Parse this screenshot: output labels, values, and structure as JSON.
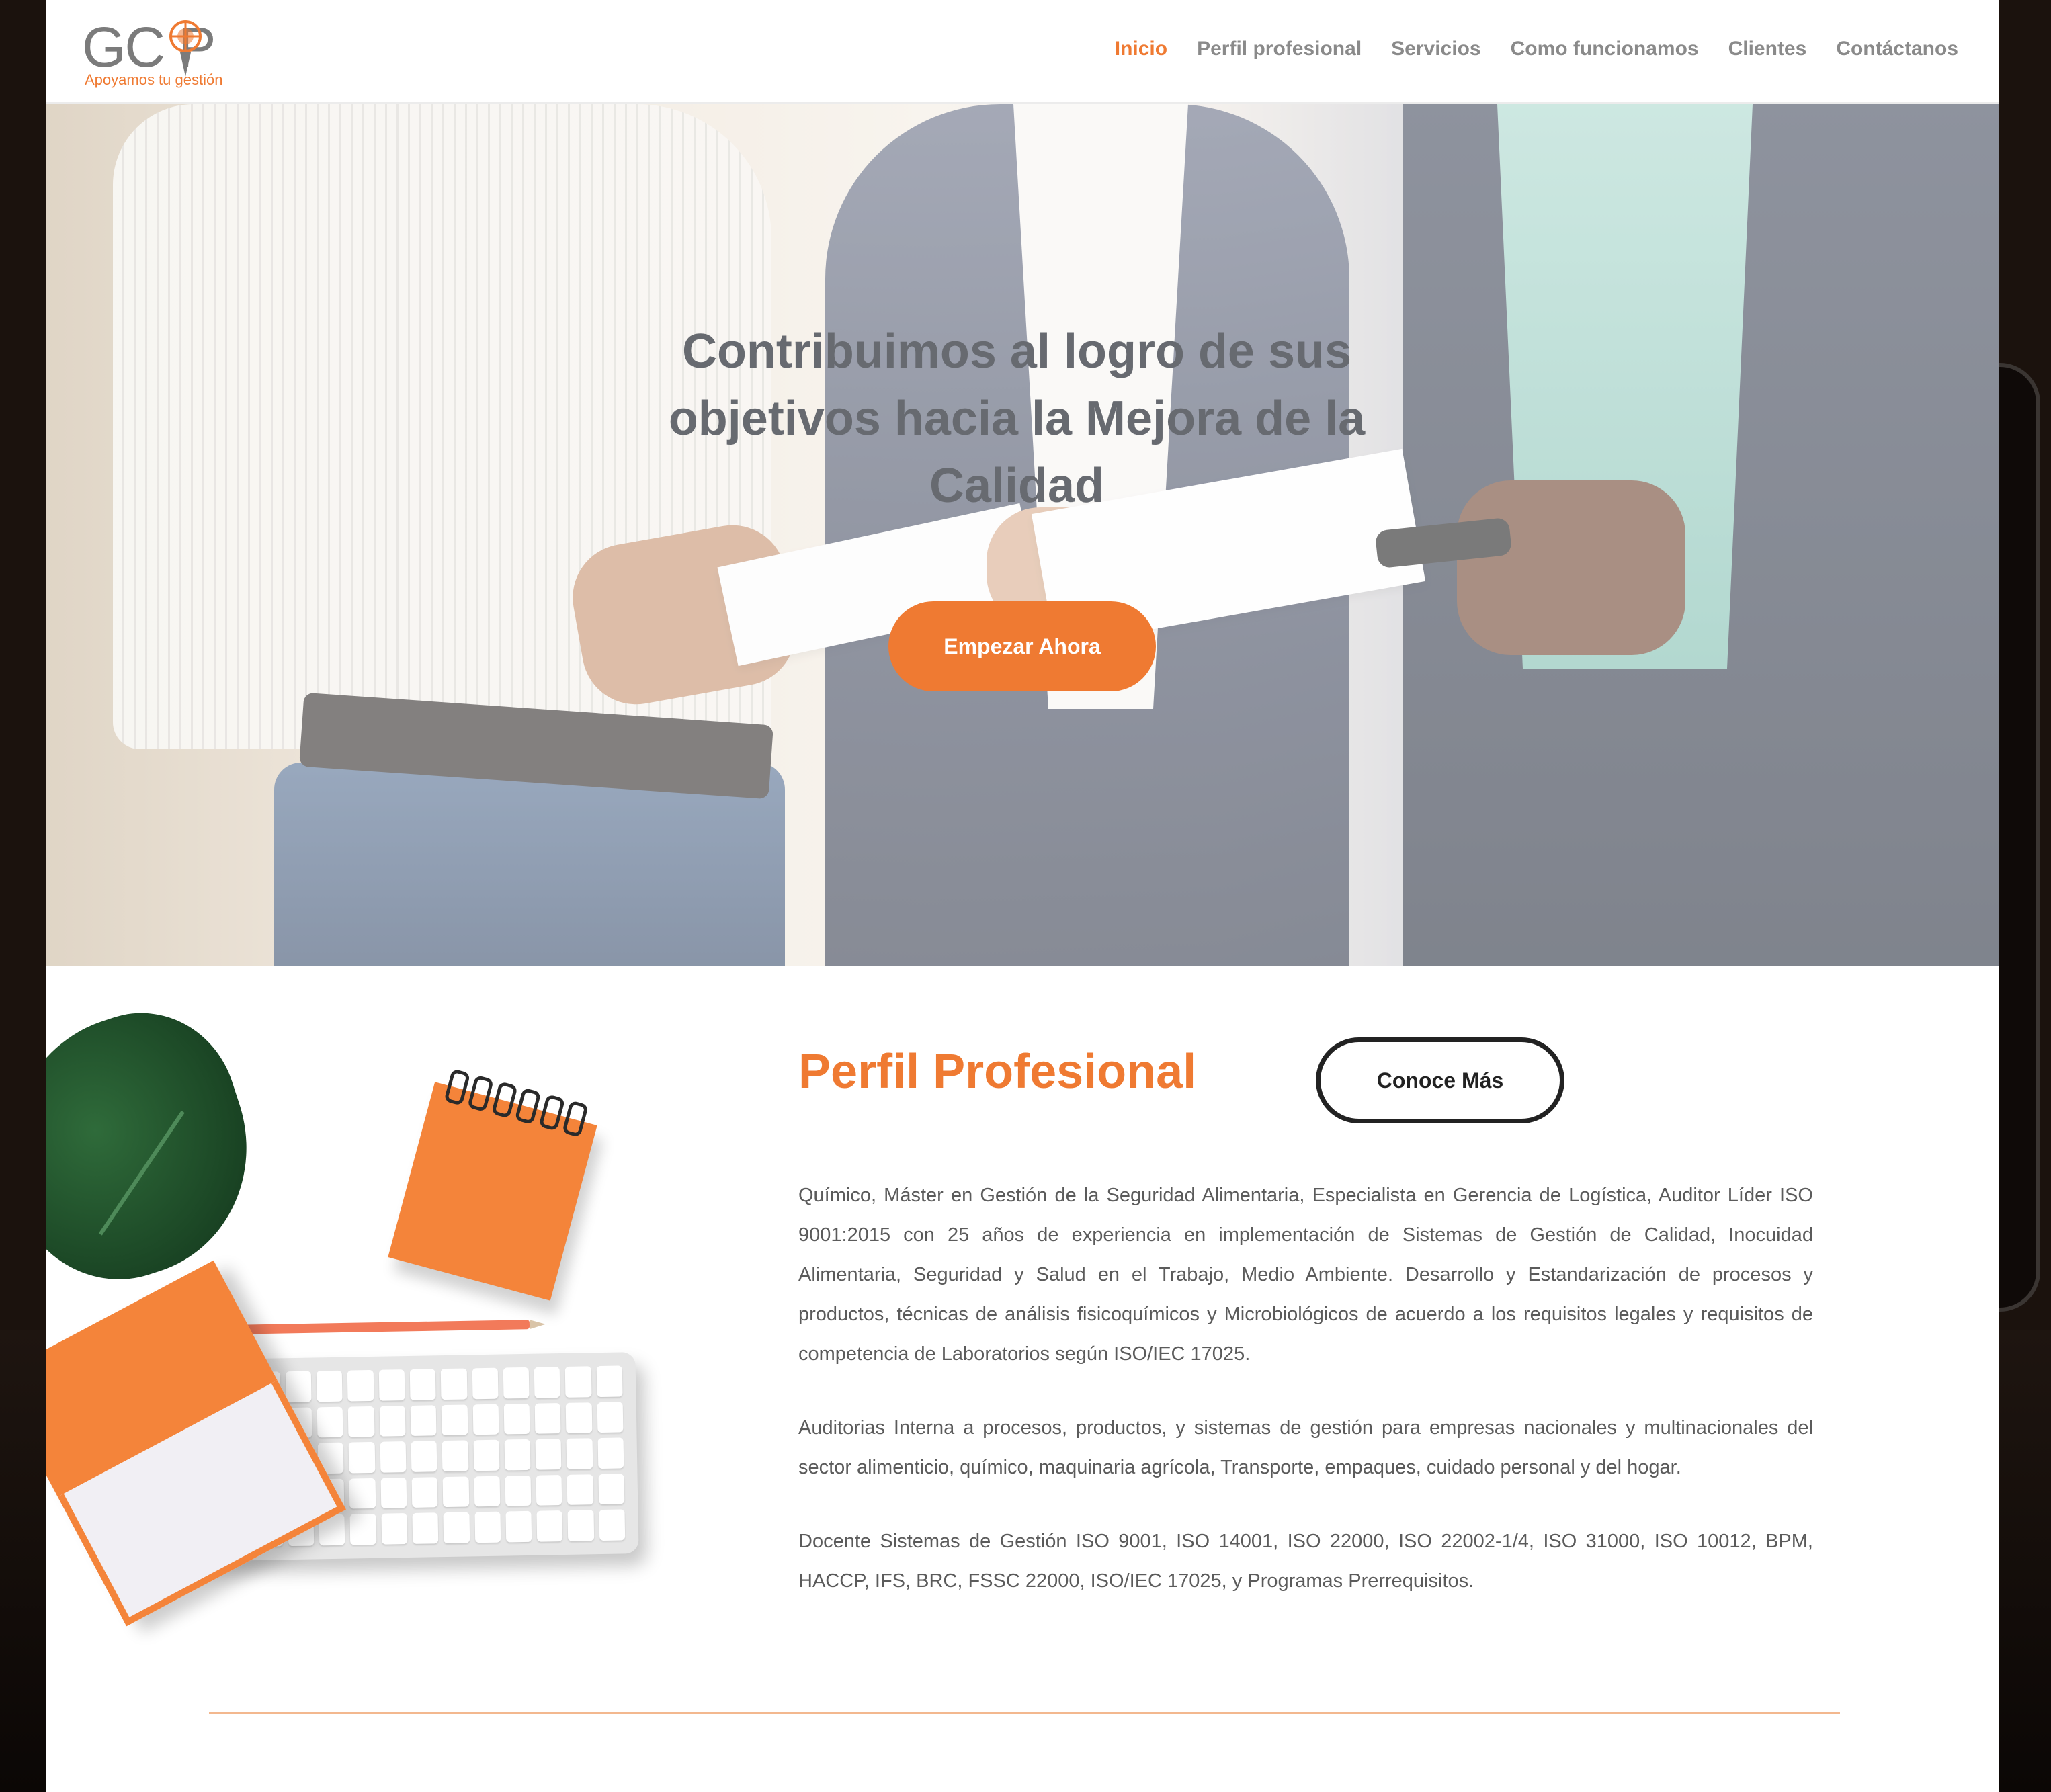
{
  "colors": {
    "accent": "#ef7a32",
    "nav_text": "#8a8a8a",
    "hero_text": "#676a70",
    "body_text": "#5b5b5b",
    "divider": "#f3b88f"
  },
  "header": {
    "logo_text": "GC P",
    "logo_tagline": "Apoyamos tu gestión",
    "nav": [
      {
        "label": "Inicio",
        "active": true
      },
      {
        "label": "Perfil profesional"
      },
      {
        "label": "Servicios"
      },
      {
        "label": "Como funcionamos"
      },
      {
        "label": "Clientes"
      },
      {
        "label": "Contáctanos"
      }
    ]
  },
  "hero": {
    "title": "Contribuimos al logro de sus objetivos hacia la Mejora de la Calidad",
    "cta_label": "Empezar Ahora"
  },
  "profile": {
    "title": "Perfil Profesional",
    "button_label": "Conoce Más",
    "paragraphs": [
      "Químico, Máster en Gestión de la Seguridad Alimentaria, Especialista en Gerencia de Logística, Auditor Líder ISO 9001:2015 con 25 años de experiencia en implementación de Sistemas de Gestión de Calidad, Inocuidad Alimentaria, Seguridad y Salud en el Trabajo, Medio Ambiente. Desarrollo y Estandarización de procesos y productos, técnicas de análisis fisicoquímicos y Microbiológicos de acuerdo a los requisitos legales y requisitos de competencia de Laboratorios según ISO/IEC 17025.",
      "Auditorias Interna a procesos, productos, y sistemas de gestión para empresas nacionales y multinacionales del sector alimenticio, químico, maquinaria agrícola, Transporte, empaques, cuidado personal y del hogar.",
      "Docente Sistemas de Gestión ISO 9001, ISO 14001, ISO 22000, ISO 22002-1/4, ISO 31000, ISO 10012, BPM, HACCP, IFS, BRC, FSSC 22000, ISO/IEC 17025, y Programas Prerrequisitos."
    ]
  }
}
